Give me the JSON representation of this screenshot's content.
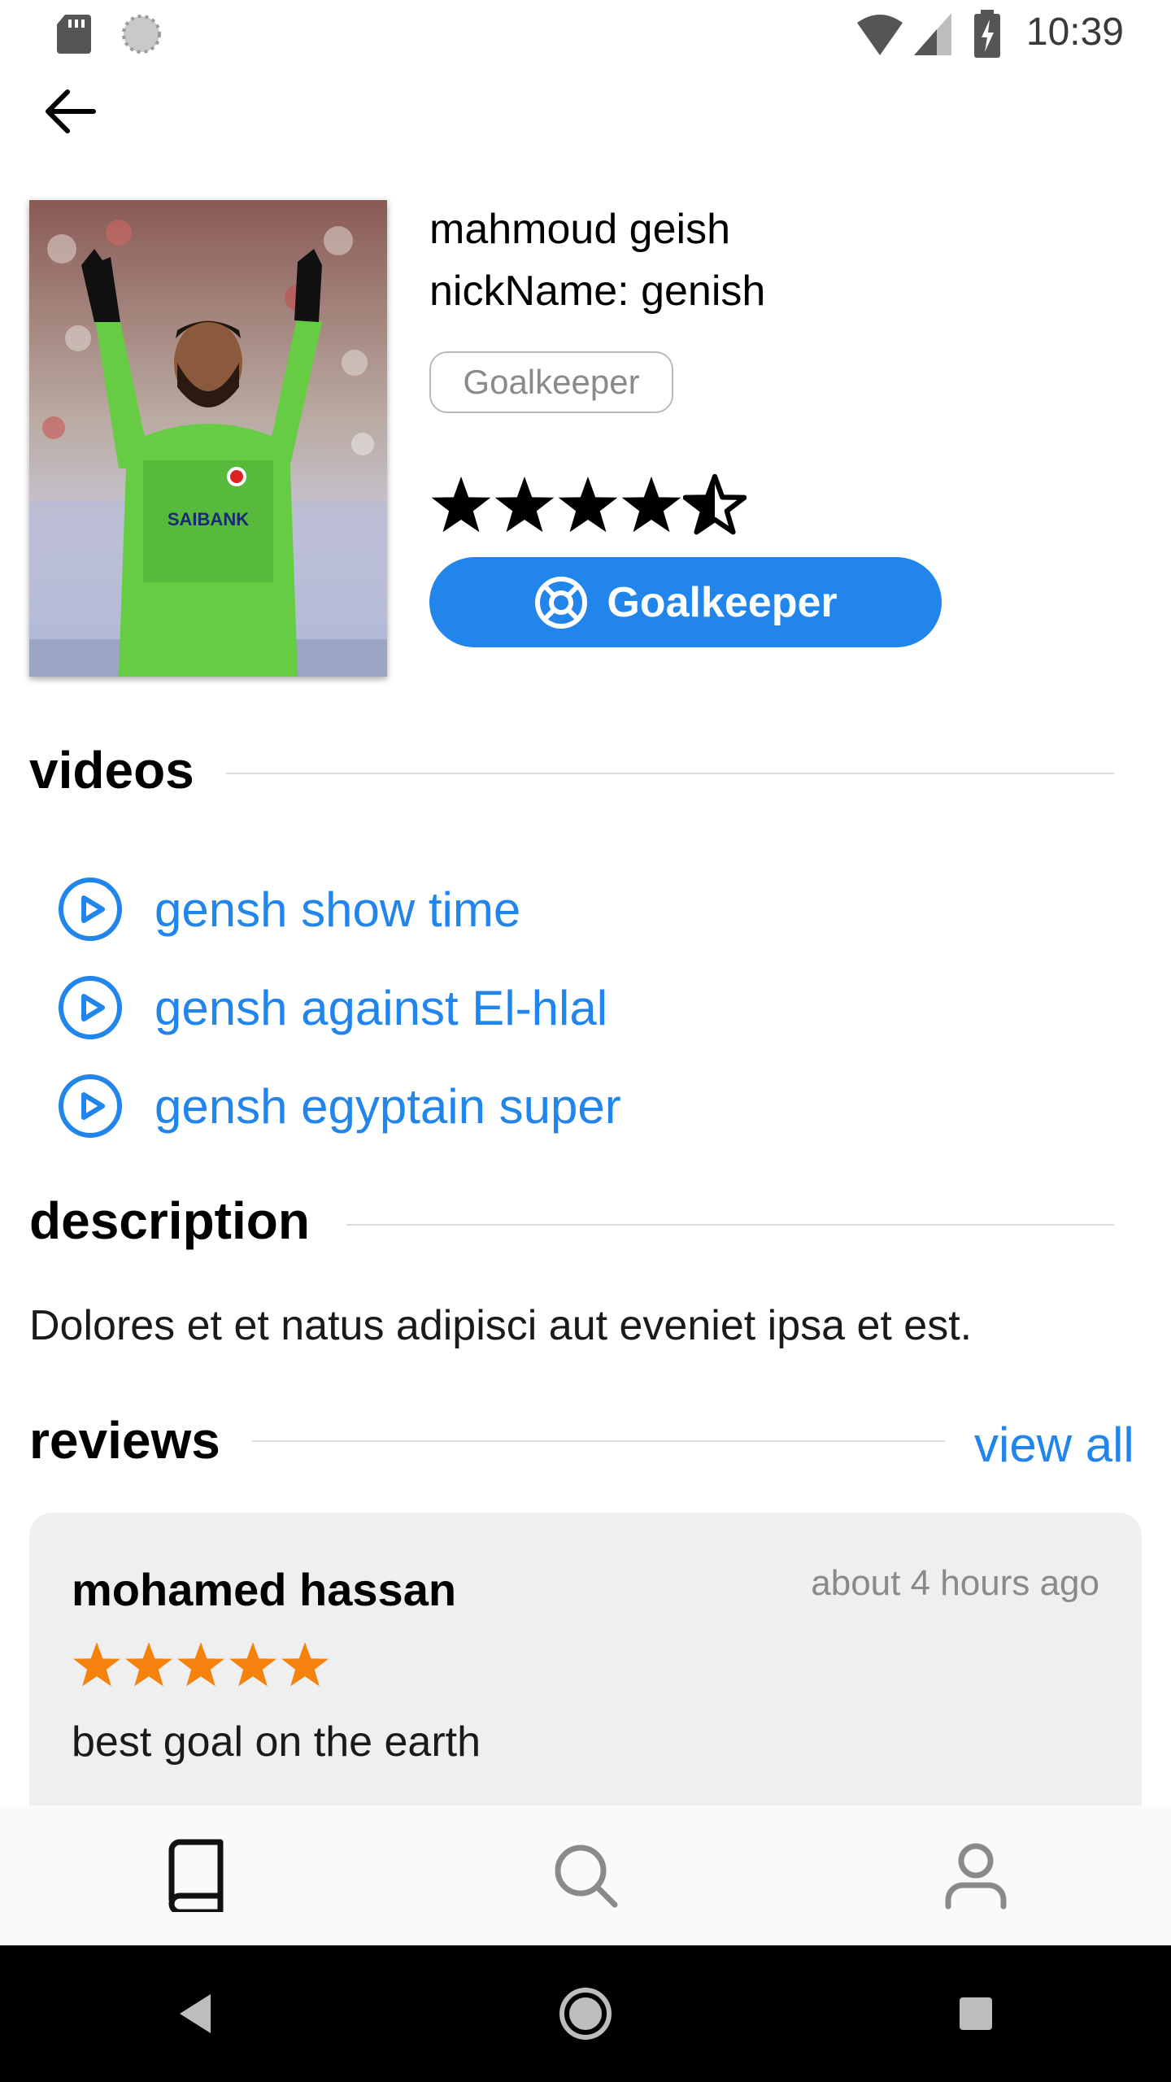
{
  "status_bar": {
    "time": "10:39"
  },
  "player": {
    "name": "mahmoud geish",
    "nickname": "nickName: genish",
    "position_chip": "Goalkeeper",
    "rating": 4.5,
    "position_button": "Goalkeeper",
    "photo_text": "SAIBANK"
  },
  "videos": {
    "title": "videos",
    "items": [
      {
        "label": "gensh show time"
      },
      {
        "label": "gensh against El-hlal"
      },
      {
        "label": "gensh egyptain super"
      }
    ]
  },
  "description": {
    "title": "description",
    "text": "Dolores et et natus adipisci aut eveniet ipsa et est."
  },
  "reviews": {
    "title": "reviews",
    "view_all": "view all",
    "items": [
      {
        "author": "mohamed hassan",
        "time": "about 4 hours ago",
        "rating": 5,
        "text": "best goal on the earth"
      }
    ]
  },
  "bottom_nav": {
    "items": [
      {
        "icon": "book-icon",
        "active": true
      },
      {
        "icon": "search-icon",
        "active": false
      },
      {
        "icon": "user-icon",
        "active": false
      }
    ]
  },
  "colors": {
    "accent": "#2185eb",
    "review_star": "#f5820d",
    "rating_star": "#000000",
    "card_bg": "#efefef"
  }
}
